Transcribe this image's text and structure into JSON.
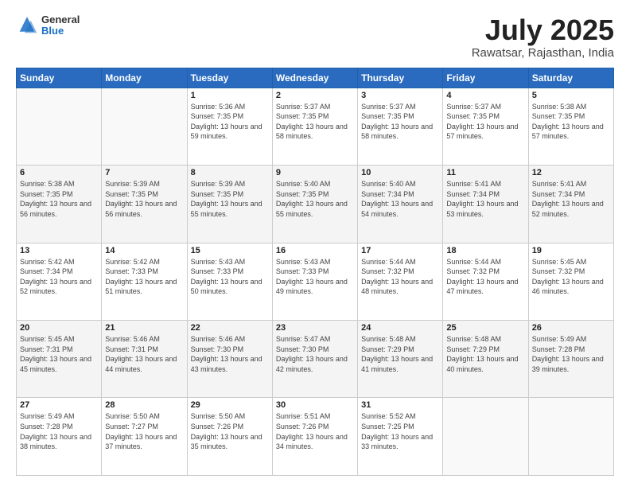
{
  "header": {
    "logo_general": "General",
    "logo_blue": "Blue",
    "title": "July 2025",
    "location": "Rawatsar, Rajasthan, India"
  },
  "days_of_week": [
    "Sunday",
    "Monday",
    "Tuesday",
    "Wednesday",
    "Thursday",
    "Friday",
    "Saturday"
  ],
  "weeks": [
    {
      "alt": false,
      "cells": [
        {
          "day": "",
          "sunrise": "",
          "sunset": "",
          "daylight": ""
        },
        {
          "day": "",
          "sunrise": "",
          "sunset": "",
          "daylight": ""
        },
        {
          "day": "1",
          "sunrise": "Sunrise: 5:36 AM",
          "sunset": "Sunset: 7:35 PM",
          "daylight": "Daylight: 13 hours and 59 minutes."
        },
        {
          "day": "2",
          "sunrise": "Sunrise: 5:37 AM",
          "sunset": "Sunset: 7:35 PM",
          "daylight": "Daylight: 13 hours and 58 minutes."
        },
        {
          "day": "3",
          "sunrise": "Sunrise: 5:37 AM",
          "sunset": "Sunset: 7:35 PM",
          "daylight": "Daylight: 13 hours and 58 minutes."
        },
        {
          "day": "4",
          "sunrise": "Sunrise: 5:37 AM",
          "sunset": "Sunset: 7:35 PM",
          "daylight": "Daylight: 13 hours and 57 minutes."
        },
        {
          "day": "5",
          "sunrise": "Sunrise: 5:38 AM",
          "sunset": "Sunset: 7:35 PM",
          "daylight": "Daylight: 13 hours and 57 minutes."
        }
      ]
    },
    {
      "alt": true,
      "cells": [
        {
          "day": "6",
          "sunrise": "Sunrise: 5:38 AM",
          "sunset": "Sunset: 7:35 PM",
          "daylight": "Daylight: 13 hours and 56 minutes."
        },
        {
          "day": "7",
          "sunrise": "Sunrise: 5:39 AM",
          "sunset": "Sunset: 7:35 PM",
          "daylight": "Daylight: 13 hours and 56 minutes."
        },
        {
          "day": "8",
          "sunrise": "Sunrise: 5:39 AM",
          "sunset": "Sunset: 7:35 PM",
          "daylight": "Daylight: 13 hours and 55 minutes."
        },
        {
          "day": "9",
          "sunrise": "Sunrise: 5:40 AM",
          "sunset": "Sunset: 7:35 PM",
          "daylight": "Daylight: 13 hours and 55 minutes."
        },
        {
          "day": "10",
          "sunrise": "Sunrise: 5:40 AM",
          "sunset": "Sunset: 7:34 PM",
          "daylight": "Daylight: 13 hours and 54 minutes."
        },
        {
          "day": "11",
          "sunrise": "Sunrise: 5:41 AM",
          "sunset": "Sunset: 7:34 PM",
          "daylight": "Daylight: 13 hours and 53 minutes."
        },
        {
          "day": "12",
          "sunrise": "Sunrise: 5:41 AM",
          "sunset": "Sunset: 7:34 PM",
          "daylight": "Daylight: 13 hours and 52 minutes."
        }
      ]
    },
    {
      "alt": false,
      "cells": [
        {
          "day": "13",
          "sunrise": "Sunrise: 5:42 AM",
          "sunset": "Sunset: 7:34 PM",
          "daylight": "Daylight: 13 hours and 52 minutes."
        },
        {
          "day": "14",
          "sunrise": "Sunrise: 5:42 AM",
          "sunset": "Sunset: 7:33 PM",
          "daylight": "Daylight: 13 hours and 51 minutes."
        },
        {
          "day": "15",
          "sunrise": "Sunrise: 5:43 AM",
          "sunset": "Sunset: 7:33 PM",
          "daylight": "Daylight: 13 hours and 50 minutes."
        },
        {
          "day": "16",
          "sunrise": "Sunrise: 5:43 AM",
          "sunset": "Sunset: 7:33 PM",
          "daylight": "Daylight: 13 hours and 49 minutes."
        },
        {
          "day": "17",
          "sunrise": "Sunrise: 5:44 AM",
          "sunset": "Sunset: 7:32 PM",
          "daylight": "Daylight: 13 hours and 48 minutes."
        },
        {
          "day": "18",
          "sunrise": "Sunrise: 5:44 AM",
          "sunset": "Sunset: 7:32 PM",
          "daylight": "Daylight: 13 hours and 47 minutes."
        },
        {
          "day": "19",
          "sunrise": "Sunrise: 5:45 AM",
          "sunset": "Sunset: 7:32 PM",
          "daylight": "Daylight: 13 hours and 46 minutes."
        }
      ]
    },
    {
      "alt": true,
      "cells": [
        {
          "day": "20",
          "sunrise": "Sunrise: 5:45 AM",
          "sunset": "Sunset: 7:31 PM",
          "daylight": "Daylight: 13 hours and 45 minutes."
        },
        {
          "day": "21",
          "sunrise": "Sunrise: 5:46 AM",
          "sunset": "Sunset: 7:31 PM",
          "daylight": "Daylight: 13 hours and 44 minutes."
        },
        {
          "day": "22",
          "sunrise": "Sunrise: 5:46 AM",
          "sunset": "Sunset: 7:30 PM",
          "daylight": "Daylight: 13 hours and 43 minutes."
        },
        {
          "day": "23",
          "sunrise": "Sunrise: 5:47 AM",
          "sunset": "Sunset: 7:30 PM",
          "daylight": "Daylight: 13 hours and 42 minutes."
        },
        {
          "day": "24",
          "sunrise": "Sunrise: 5:48 AM",
          "sunset": "Sunset: 7:29 PM",
          "daylight": "Daylight: 13 hours and 41 minutes."
        },
        {
          "day": "25",
          "sunrise": "Sunrise: 5:48 AM",
          "sunset": "Sunset: 7:29 PM",
          "daylight": "Daylight: 13 hours and 40 minutes."
        },
        {
          "day": "26",
          "sunrise": "Sunrise: 5:49 AM",
          "sunset": "Sunset: 7:28 PM",
          "daylight": "Daylight: 13 hours and 39 minutes."
        }
      ]
    },
    {
      "alt": false,
      "cells": [
        {
          "day": "27",
          "sunrise": "Sunrise: 5:49 AM",
          "sunset": "Sunset: 7:28 PM",
          "daylight": "Daylight: 13 hours and 38 minutes."
        },
        {
          "day": "28",
          "sunrise": "Sunrise: 5:50 AM",
          "sunset": "Sunset: 7:27 PM",
          "daylight": "Daylight: 13 hours and 37 minutes."
        },
        {
          "day": "29",
          "sunrise": "Sunrise: 5:50 AM",
          "sunset": "Sunset: 7:26 PM",
          "daylight": "Daylight: 13 hours and 35 minutes."
        },
        {
          "day": "30",
          "sunrise": "Sunrise: 5:51 AM",
          "sunset": "Sunset: 7:26 PM",
          "daylight": "Daylight: 13 hours and 34 minutes."
        },
        {
          "day": "31",
          "sunrise": "Sunrise: 5:52 AM",
          "sunset": "Sunset: 7:25 PM",
          "daylight": "Daylight: 13 hours and 33 minutes."
        },
        {
          "day": "",
          "sunrise": "",
          "sunset": "",
          "daylight": ""
        },
        {
          "day": "",
          "sunrise": "",
          "sunset": "",
          "daylight": ""
        }
      ]
    }
  ]
}
